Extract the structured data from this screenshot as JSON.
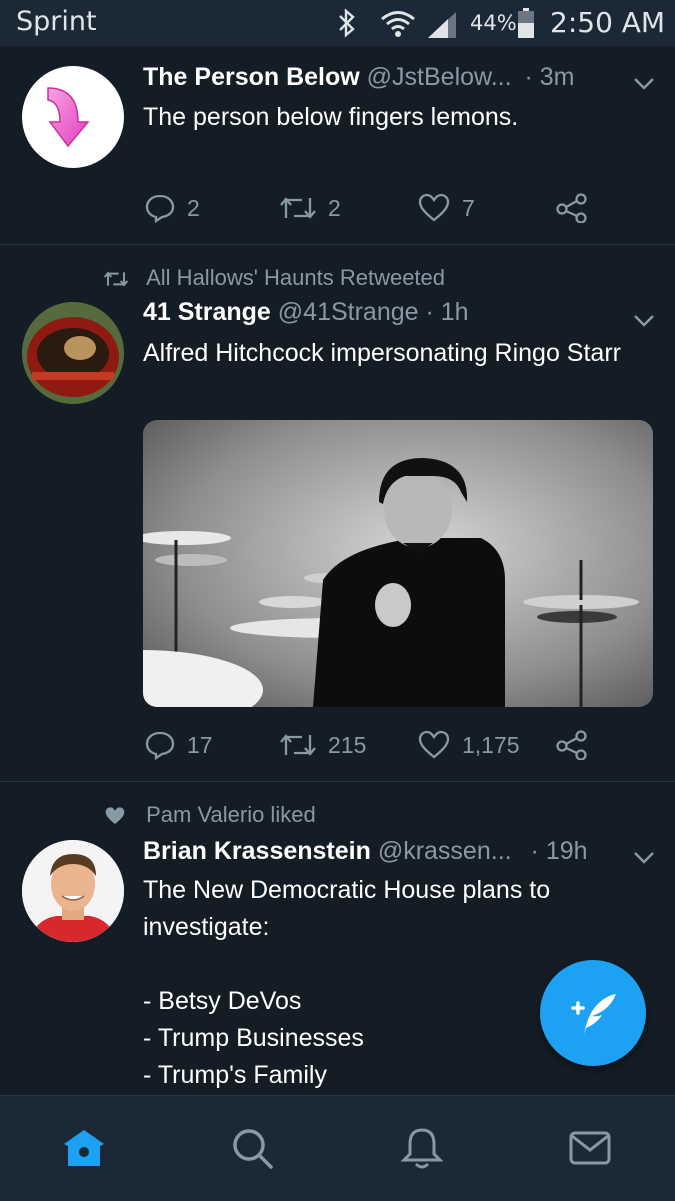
{
  "status": {
    "carrier": "Sprint",
    "battery": "44%",
    "time": "2:50 AM"
  },
  "tweets": [
    {
      "name": "The Person Below",
      "handle": "@JstBelow...",
      "time": "· 3m",
      "text": "The person below fingers lemons.",
      "replies": "2",
      "retweets": "2",
      "likes": "7"
    },
    {
      "social_context": "All Hallows' Haunts Retweeted",
      "name": "41 Strange",
      "handle": "@41Strange · 1h",
      "time": "",
      "text": "Alfred Hitchcock impersonating Ringo Starr",
      "replies": "17",
      "retweets": "215",
      "likes": "1,175"
    },
    {
      "social_context": "Pam Valerio liked",
      "name": "Brian Krassenstein",
      "handle": "@krassen...",
      "time": "· 19h",
      "text": "The New Democratic House plans to investigate:\n\n- Betsy DeVos\n- Trump Businesses\n- Trump's Family"
    }
  ],
  "colors": {
    "background": "#141d26",
    "bar": "#1b2836",
    "secondary_text": "#8899a6",
    "accent": "#1da1f2"
  },
  "icons": {
    "tabs": [
      "home-icon",
      "search-icon",
      "notifications-icon",
      "messages-icon"
    ],
    "fab": "compose-tweet-icon"
  }
}
